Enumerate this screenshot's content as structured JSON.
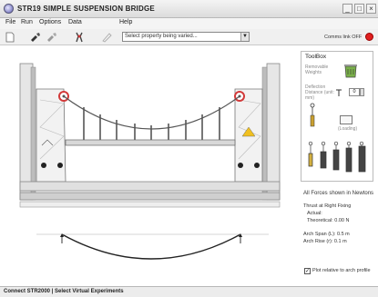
{
  "window": {
    "title": "STR19 SIMPLE SUSPENSION BRIDGE",
    "controls": [
      "_",
      "□",
      "×"
    ]
  },
  "menu": [
    "File",
    "Run",
    "Options",
    "Data",
    "Help"
  ],
  "toolbar": {
    "property_select_placeholder": "Select property being varied...",
    "comms_label": "Comms link OFF",
    "comms_status_color": "#e02020"
  },
  "toolbox": {
    "title": "ToolBox",
    "removable_weights": "Removable Weights",
    "deflection_label": "Deflection Distance (unit: mm)",
    "spinner_value": "0",
    "load_label": "(Loading)",
    "icons": [
      "trash-icon",
      "dial-gauge-icon",
      "weight-hanger-icon"
    ]
  },
  "results": {
    "forces_title": "All Forces shown in Newtons",
    "thrust_title": "Thrust at Right Fixing",
    "actual_label": "Actual:",
    "theoretical_label": "Theoretical: 0.00 N",
    "arch_span": "Arch Span (L):  0.5 m",
    "arch_rise": "Arch Rise (r):  0.1 m"
  },
  "plot_checkbox": {
    "checked": true,
    "label": "Plot relative to arch profile"
  },
  "status_bar": "Connect STR2000 | Select Virtual Experiments",
  "colors": {
    "frame": "#c8c8c8",
    "pulley": "#d23a3a",
    "warning_label": "#f0c020"
  }
}
